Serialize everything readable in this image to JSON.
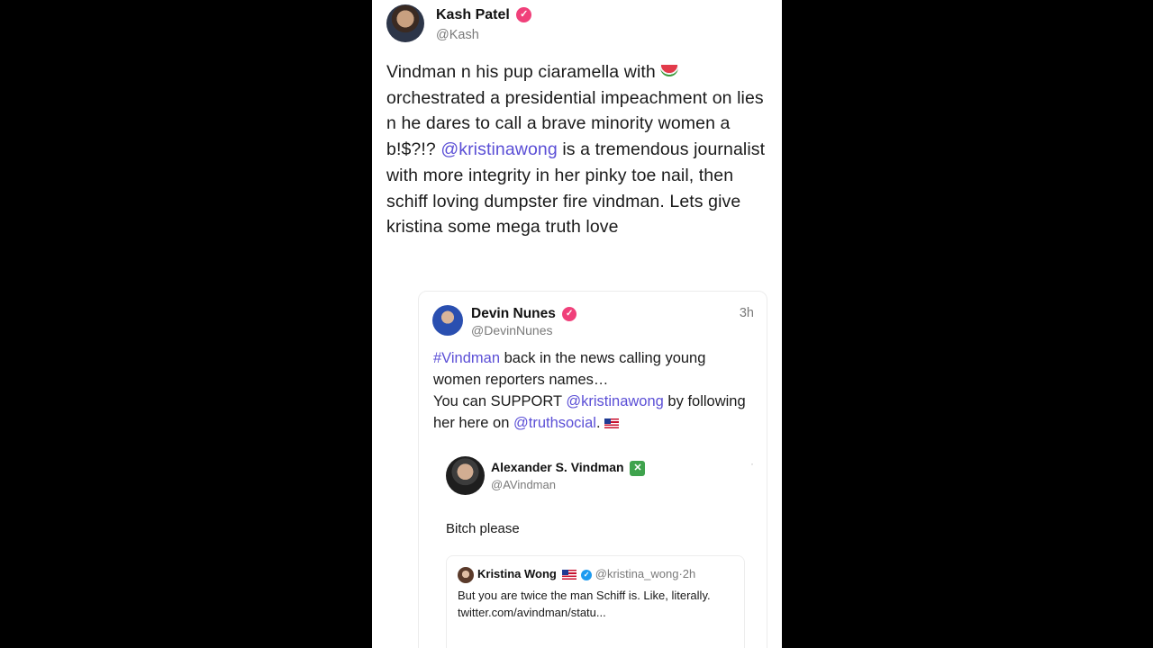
{
  "post": {
    "author": {
      "name": "Kash Patel",
      "handle": "@Kash"
    },
    "text_parts": {
      "p1": "Vindman n his pup ciaramella with ",
      "p2": " orchestrated a presidential impeachment on lies n he dares to call a brave minority women a b!$?!? ",
      "mention": "@kristinawong",
      "p3": " is a tremendous journalist with more integrity in her pinky toe nail, then schiff loving dumpster fire vindman. Lets give kristina some mega truth love"
    },
    "emoji_icon": "watermelon-icon"
  },
  "quoted": {
    "author": {
      "name": "Devin Nunes",
      "handle": "@DevinNunes"
    },
    "time": "3h",
    "text_parts": {
      "hashtag": "#Vindman",
      "t1": " back in the news calling young women reporters names…",
      "t2": "You can SUPPORT ",
      "mention1": "@kristinawong",
      "t3": " by following her here on ",
      "mention2": "@truthsocial",
      "t4": ". "
    },
    "flag_icon": "us-flag-icon"
  },
  "tweet": {
    "author": {
      "name": "Alexander S. Vindman",
      "handle": "@AVindman"
    },
    "text": "Bitch please",
    "dot": "·"
  },
  "inner_tweet": {
    "author": {
      "name": "Kristina Wong",
      "handle": "@kristina_wong",
      "sep": "·",
      "time": "2h"
    },
    "line1": "But you are twice the man Schiff is. Like, literally.",
    "line2": "twitter.com/avindman/statu..."
  },
  "colors": {
    "link": "#5b4fd6",
    "truth_badge": "#f0407a",
    "x_badge": "#3fa34d",
    "twitter_verified": "#1d9bf0",
    "background": "#000000",
    "card": "#ffffff"
  }
}
